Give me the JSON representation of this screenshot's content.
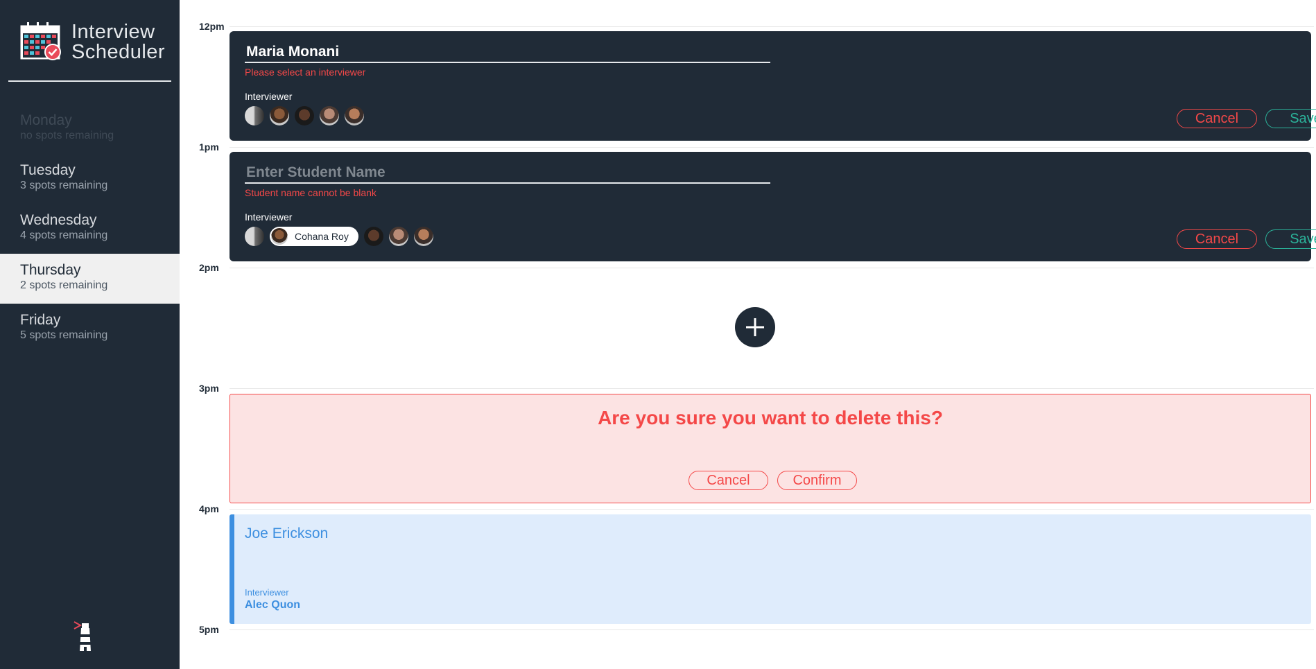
{
  "app": {
    "title_line1": "Interview",
    "title_line2": "Scheduler"
  },
  "colors": {
    "sidebar_bg": "#202b37",
    "danger": "#f44848",
    "confirm": "#2bb39a",
    "accent_blue": "#3d8fe0",
    "show_bg": "#dfecfc",
    "confirm_bg": "#fce3e3"
  },
  "days": [
    {
      "name": "Monday",
      "spots": "no spots remaining",
      "state": "full"
    },
    {
      "name": "Tuesday",
      "spots": "3 spots remaining",
      "state": "normal"
    },
    {
      "name": "Wednesday",
      "spots": "4 spots remaining",
      "state": "normal"
    },
    {
      "name": "Thursday",
      "spots": "2 spots remaining",
      "state": "selected"
    },
    {
      "name": "Friday",
      "spots": "5 spots remaining",
      "state": "normal"
    }
  ],
  "hours": [
    "12pm",
    "1pm",
    "2pm",
    "3pm",
    "4pm",
    "5pm"
  ],
  "form1": {
    "student_value": "Maria Monani",
    "validation": "Please select an interviewer",
    "interviewer_label": "Interviewer",
    "cancel_label": "Cancel",
    "save_label": "Save"
  },
  "form2": {
    "student_placeholder": "Enter Student Name",
    "validation": "Student name cannot be blank",
    "interviewer_label": "Interviewer",
    "selected_interviewer": "Cohana Roy",
    "cancel_label": "Cancel",
    "save_label": "Save"
  },
  "confirm": {
    "message": "Are you sure you want to delete this?",
    "cancel_label": "Cancel",
    "confirm_label": "Confirm"
  },
  "show": {
    "student": "Joe Erickson",
    "interviewer_label": "Interviewer",
    "interviewer_name": "Alec Quon"
  },
  "icons": {
    "logo": "calendar-check-icon",
    "add": "plus-icon",
    "footer": "lighthouse-icon"
  }
}
